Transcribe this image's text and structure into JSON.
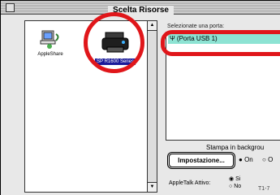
{
  "window": {
    "title": "Scelta Risorse"
  },
  "chooser": {
    "items": [
      {
        "label": "AppleShare",
        "icon": "appleshare-icon"
      },
      {
        "label": "SP R1600 Series",
        "icon": "printer-icon",
        "selected": true
      }
    ]
  },
  "ports": {
    "label": "Selezionate una porta:",
    "items": [
      {
        "label": "(Porta USB 1)",
        "icon": "usb-icon",
        "selected": true
      }
    ]
  },
  "background_printing": {
    "label": "Stampa in backgrou",
    "on_label": "On",
    "off_label": "O",
    "selected": "On"
  },
  "setup_button": {
    "label": "Impostazione..."
  },
  "appletalk": {
    "label": "AppleTalk Attivo:",
    "yes_label": "Si",
    "no_label": "No",
    "selected": "No"
  },
  "version": "T1-7"
}
